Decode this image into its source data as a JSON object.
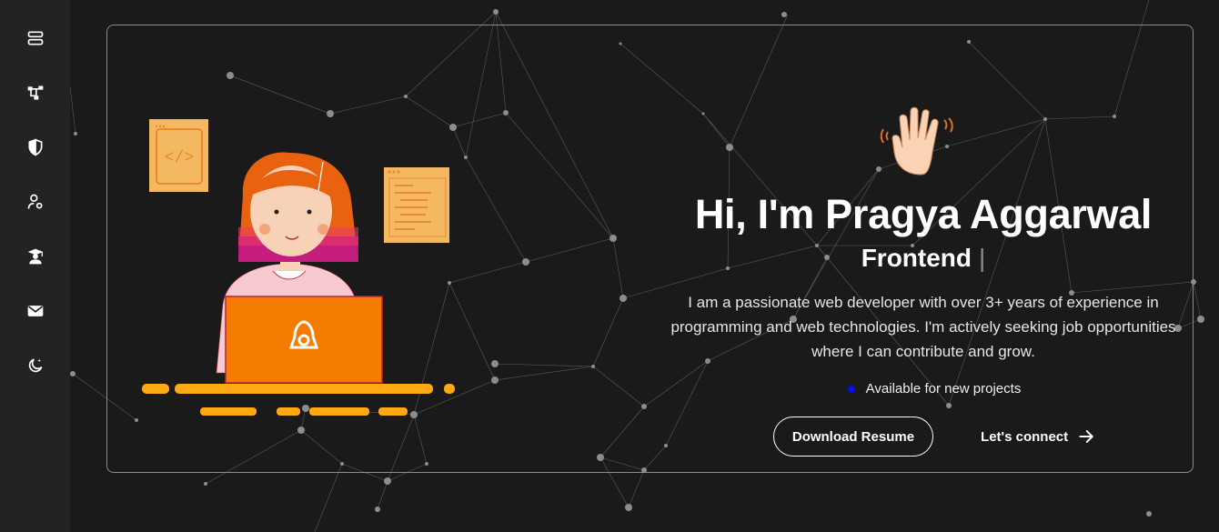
{
  "sidebar": {
    "items": [
      {
        "icon": "server-stack-icon"
      },
      {
        "icon": "hierarchy-icon"
      },
      {
        "icon": "shield-icon"
      },
      {
        "icon": "user-settings-icon"
      },
      {
        "icon": "graduate-icon"
      },
      {
        "icon": "envelope-icon"
      },
      {
        "icon": "theme-moon-icon"
      }
    ]
  },
  "hero": {
    "greeting": "Hi, I'm Pragya Aggarwal",
    "role": "Frontend",
    "cursor": "|",
    "bio": "I am a passionate web developer with over 3+ years of experience in programming and web technologies. I'm actively seeking job opportunities where I can contribute and grow.",
    "status": "Available for new projects",
    "download_label": "Download Resume",
    "connect_label": "Let's connect"
  },
  "colors": {
    "background": "#1a1a1b",
    "sidebar": "#232325",
    "accent_orange": "#f57c00",
    "status_dot": "#0b0bea"
  }
}
